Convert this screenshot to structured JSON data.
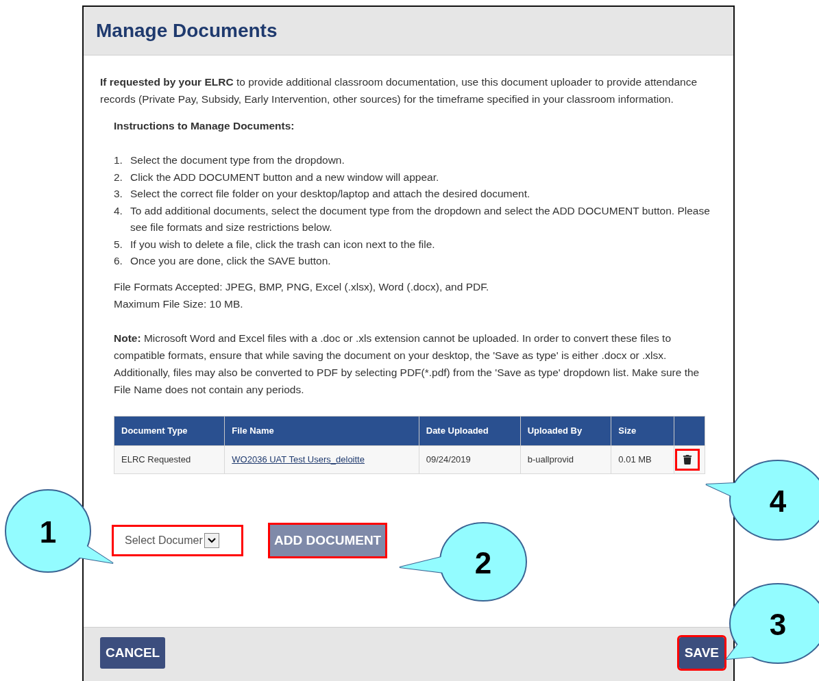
{
  "dialog": {
    "title": "Manage Documents",
    "intro": "**If requested by your ELRC** to provide additional classroom documentation, use this document uploader to provide attendance records (Private Pay, Subsidy, Early Intervention, other sources) for the timeframe specified in your classroom information.",
    "instructions_heading": "Instructions to Manage Documents:",
    "instructions": [
      {
        "number": "1.",
        "text": "Select the document type from the dropdown."
      },
      {
        "number": "2.",
        "text": "Click the ADD DOCUMENT button and a new window will appear."
      },
      {
        "number": "3.",
        "text": "Select the correct file folder on your desktop/laptop and attach the desired document."
      },
      {
        "number": "4.",
        "text": "To add additional documents, select the document type from the dropdown and select the ADD DOCUMENT button. Please see file formats and size restrictions below."
      },
      {
        "number": "5.",
        "text": "If you wish to delete a file, click the trash can icon next to the file."
      },
      {
        "number": "6.",
        "text": "Once you are done, click the SAVE button."
      }
    ],
    "formats": "File Formats Accepted: JPEG, BMP, PNG, Excel (.xlsx), Word (.docx), and PDF.",
    "max_size": "Maximum File Size: 10 MB.",
    "note": "**Note:** Microsoft Word and Excel files with a .doc or .xls extension cannot be uploaded. In order to convert these files to compatible formats, ensure that while saving the document on your desktop, the 'Save as type' is either .docx or .xlsx. Additionally, files may also be converted to PDF by selecting PDF(*.pdf) from the 'Save as type' dropdown list. Make sure the File Name does not contain any periods.",
    "table": {
      "columns": [
        "Document Type",
        "File Name",
        "Date Uploaded",
        "Uploaded By",
        "Size"
      ],
      "rows": [
        {
          "document_type": "ELRC Requested",
          "file_name": "WO2036 UAT Test Users_deloitte",
          "date_uploaded": "09/24/2019",
          "uploaded_by": "b-uallprovid",
          "size": "0.01 MB",
          "delete_highlighted": true
        }
      ]
    },
    "document_select": {
      "value": "Select Documer",
      "highlighted": true
    },
    "add_button": {
      "label": "ADD DOCUMENT",
      "highlighted": true
    },
    "cancel_button": {
      "label": "CANCEL",
      "highlighted": false
    },
    "save_button": {
      "label": "SAVE",
      "highlighted": true
    }
  },
  "callouts": [
    {
      "label": "1"
    },
    {
      "label": "2"
    },
    {
      "label": "3"
    },
    {
      "label": "4"
    }
  ]
}
